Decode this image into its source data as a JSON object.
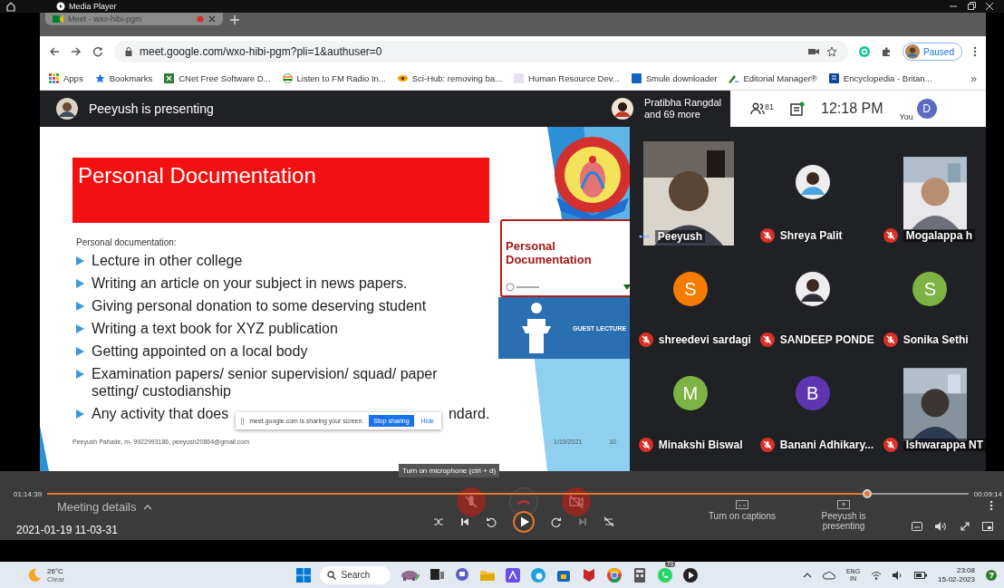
{
  "media_player": {
    "title": "Media Player"
  },
  "browser": {
    "tab_title": "Meet - wxo-hibi-pgm",
    "url": "meet.google.com/wxo-hibi-pgm?pli=1&authuser=0",
    "profile_status": "Paused",
    "bookmarks": [
      {
        "label": "Apps",
        "kind": "grid"
      },
      {
        "label": "Bookmarks",
        "kind": "star"
      },
      {
        "label": "CNet Free Software D...",
        "kind": "green"
      },
      {
        "label": "Listen to FM Radio In...",
        "kind": "flag"
      },
      {
        "label": "Sci-Hub: removing ba...",
        "kind": "eye"
      },
      {
        "label": "Human Resource Dev...",
        "kind": "blank"
      },
      {
        "label": "Smule downloader",
        "kind": "blue"
      },
      {
        "label": "Editorial Manager®",
        "kind": "pen"
      },
      {
        "label": "Encyclopedia - Britan...",
        "kind": "book"
      }
    ],
    "bookmarks_overflow": "»"
  },
  "meet_bar": {
    "presenter": "Peeyush is presenting",
    "preview_name": "Pratibha Rangdal",
    "preview_more": "and 69 more",
    "people_count": "81",
    "time": "12:18 PM",
    "you_label": "You",
    "avatar_letter": "D"
  },
  "slide": {
    "title": "Personal Documentation",
    "subtitle": "Personal documentation:",
    "bullets": [
      {
        "text": "Lecture in other college"
      },
      {
        "text": "Writing an article on your subject in news papers."
      },
      {
        "text": "Giving personal donation to some deserving student"
      },
      {
        "text": "Writing a text book for XYZ publication"
      },
      {
        "text": "Getting appointed on a local body"
      },
      {
        "text": "Examination papers/ senior supervision/ squad/ paper setting/ custodianship"
      },
      {
        "text": "Any activity that does",
        "tail": "ndard."
      }
    ],
    "card_title": "Personal Documentation",
    "lecture_title": "GUEST LECTURE",
    "footer_contact": "Peeyush Pahade, m- 9922993186, peeyush20864@gmail.com",
    "footer_date": "1/19/2021",
    "page_number": "10"
  },
  "share_notice": {
    "text": "meet.google.com is sharing your screen.",
    "stop_button": "Stop sharing",
    "hide_button": "Hide"
  },
  "tiles": [
    {
      "name": "Peeyush",
      "kind": "video",
      "muted": false
    },
    {
      "name": "Shreya Palit",
      "muted": true
    },
    {
      "name": "Mogalappa h",
      "kind": "video",
      "muted": true
    },
    {
      "name": "shreedevi sardagi",
      "kind": "letter",
      "letter": "S",
      "color": "#f57c00",
      "muted": true
    },
    {
      "name": "SANDEEP PONDE",
      "muted": true
    },
    {
      "name": "Sonika Sethi",
      "kind": "letter",
      "letter": "S",
      "color": "#7cb342",
      "muted": true
    },
    {
      "name": "Minakshi Biswal",
      "kind": "letter",
      "letter": "M",
      "color": "#7cb342",
      "muted": true
    },
    {
      "name": "Banani Adhikary...",
      "kind": "letter",
      "letter": "B",
      "color": "#5e35b1",
      "muted": true
    },
    {
      "name": "Ishwarappa NT",
      "kind": "video",
      "muted": true
    }
  ],
  "tooltip": "Turn on microphone (ctrl + d)",
  "player": {
    "current_time": "01:14:39",
    "end_time": "00:09:14",
    "level": 0.89,
    "meeting_details": "Meeting details",
    "file_name": "2021-01-19 11-03-31",
    "captions_label": "Turn on captions",
    "presenting_label": "Peeyush is presenting"
  },
  "taskbar": {
    "temperature": "26°C",
    "weather": "Clear",
    "search_placeholder": "Search",
    "chat_badge": "70",
    "language": "ENG",
    "region": "IN",
    "time": "23:08",
    "date": "15-02-2023"
  }
}
